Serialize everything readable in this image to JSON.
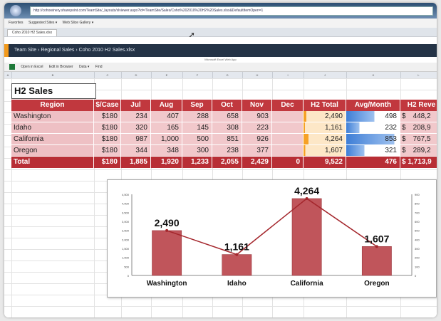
{
  "browser": {
    "address": "http://cohowinery.sharepoint.com/TeamSite/_layouts/xlviewer.aspx?id=/TeamSite/Sales/Coho%202010%20H2%20Sales.xlsx&DefaultItemOpen=1",
    "favorites_label": "Favorites",
    "suggested_sites": "Suggested Sites ▾",
    "web_slice_gallery": "Web Slice Gallery ▾",
    "tab_title": "Coho 2010 H2 Sales.xlsx"
  },
  "sharepoint": {
    "breadcrumb": "Team Site  ›  Regional Sales  ›  Coho 2010 H2 Sales.xlsx",
    "web_app_label": "Microsoft Excel Web App"
  },
  "toolbar": {
    "open_in_excel": "Open in Excel",
    "edit_in_browser": "Edit in Browser",
    "data": "Data ▾",
    "find": "Find"
  },
  "columns": [
    "A",
    "B",
    "C",
    "D",
    "E",
    "F",
    "G",
    "H",
    "I",
    "J",
    "K",
    "L"
  ],
  "sheet": {
    "title": "H2 Sales",
    "headers": [
      "Region",
      "$/Case",
      "Jul",
      "Aug",
      "Sep",
      "Oct",
      "Nov",
      "Dec",
      "H2 Total",
      "Avg/Month",
      "H2 Reve"
    ],
    "rows": [
      {
        "region": "Washington",
        "case": "$180",
        "jul": "234",
        "aug": "407",
        "sep": "288",
        "oct": "658",
        "nov": "903",
        "dec": "",
        "total": "2,490",
        "avg": "498",
        "rev_sym": "$",
        "rev": "448,2",
        "total_val": 2490,
        "avg_val": 498
      },
      {
        "region": "Idaho",
        "case": "$180",
        "jul": "320",
        "aug": "165",
        "sep": "145",
        "oct": "308",
        "nov": "223",
        "dec": "",
        "total": "1,161",
        "avg": "232",
        "rev_sym": "$",
        "rev": "208,9",
        "total_val": 1161,
        "avg_val": 232
      },
      {
        "region": "California",
        "case": "$180",
        "jul": "987",
        "aug": "1,000",
        "sep": "500",
        "oct": "851",
        "nov": "926",
        "dec": "",
        "total": "4,264",
        "avg": "853",
        "rev_sym": "$",
        "rev": "767,5",
        "total_val": 4264,
        "avg_val": 853
      },
      {
        "region": "Oregon",
        "case": "$180",
        "jul": "344",
        "aug": "348",
        "sep": "300",
        "oct": "238",
        "nov": "377",
        "dec": "",
        "total": "1,607",
        "avg": "321",
        "rev_sym": "$",
        "rev": "289,2",
        "total_val": 1607,
        "avg_val": 321
      }
    ],
    "total_row": {
      "region": "Total",
      "case": "$180",
      "jul": "1,885",
      "aug": "1,920",
      "sep": "1,233",
      "oct": "2,055",
      "nov": "2,429",
      "dec": "0",
      "total": "9,522",
      "avg": "476",
      "rev": "$ 1,713,9"
    }
  },
  "chart_data": {
    "type": "bar",
    "categories": [
      "Washington",
      "Idaho",
      "California",
      "Oregon"
    ],
    "series": [
      {
        "values": [
          2490,
          1161,
          4264,
          1607
        ],
        "labels": [
          "2,490",
          "1,161",
          "4,264",
          "1,607"
        ]
      },
      {
        "values": [
          498,
          232,
          853,
          321
        ]
      }
    ],
    "ylim": [
      0,
      4500
    ],
    "y_ticks": [
      "0",
      "500",
      "1,000",
      "1,500",
      "2,000",
      "2,500",
      "3,000",
      "3,500",
      "4,000",
      "4,500"
    ],
    "y2lim": [
      0,
      900
    ],
    "y2_ticks": [
      "0",
      "100",
      "200",
      "300",
      "400",
      "500",
      "600",
      "700",
      "800",
      "900"
    ],
    "bar_color": "#c0555b",
    "line_color": "#a4262c"
  }
}
